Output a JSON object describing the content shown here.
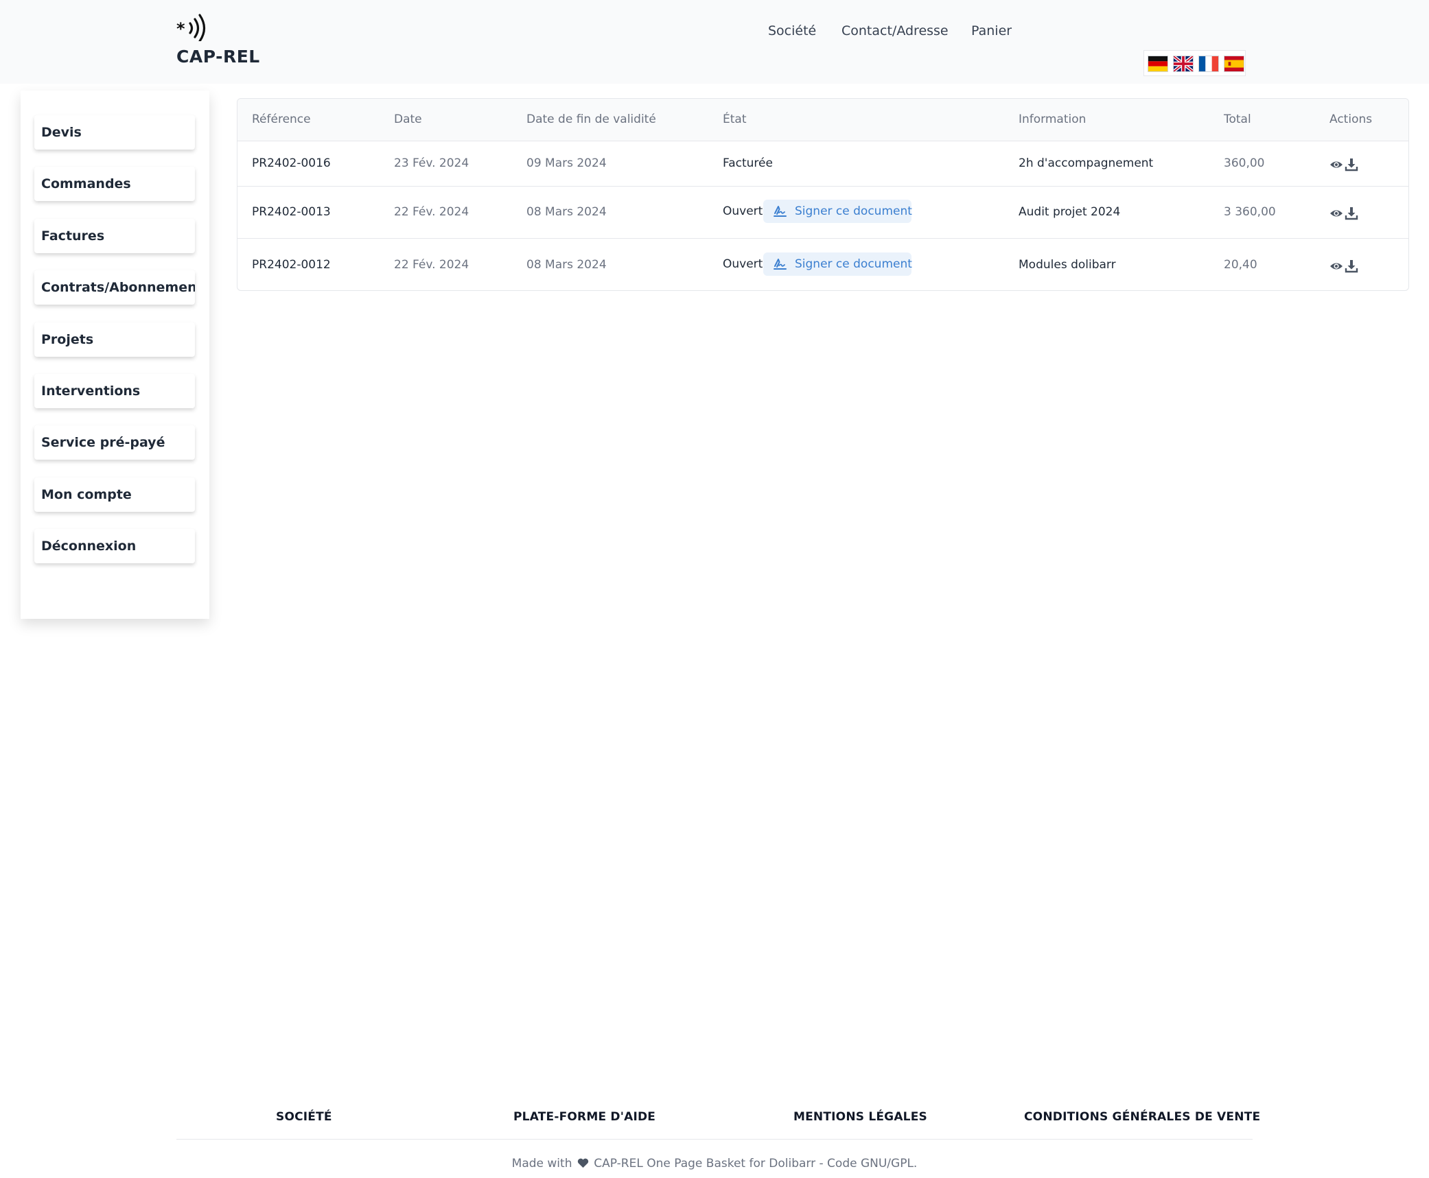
{
  "brand": {
    "name": "CAP-REL",
    "logo_icon": "nfc-waves-icon"
  },
  "nav": [
    {
      "label": "Société"
    },
    {
      "label": "Contact/Adresse"
    },
    {
      "label": "Panier"
    }
  ],
  "languages": [
    {
      "code": "de",
      "icon": "flag-germany-icon"
    },
    {
      "code": "en",
      "icon": "flag-uk-icon"
    },
    {
      "code": "fr",
      "icon": "flag-france-icon"
    },
    {
      "code": "es",
      "icon": "flag-spain-icon"
    }
  ],
  "sidebar": {
    "items": [
      {
        "label": "Devis"
      },
      {
        "label": "Commandes"
      },
      {
        "label": "Factures"
      },
      {
        "label": "Contrats/Abonnements"
      },
      {
        "label": "Projets"
      },
      {
        "label": "Interventions"
      },
      {
        "label": "Service pré-payé"
      },
      {
        "label": "Mon compte"
      },
      {
        "label": "Déconnexion"
      }
    ]
  },
  "table": {
    "columns": [
      "Référence",
      "Date",
      "Date de fin de validité",
      "État",
      "Information",
      "Total",
      "Actions"
    ],
    "rows": [
      {
        "reference": "PR2402-0016",
        "date": "23 Fév. 2024",
        "end_date": "09 Mars 2024",
        "state": "Facturée",
        "sign_label": "",
        "information": "2h d'accompagnement",
        "total": "360,00"
      },
      {
        "reference": "PR2402-0013",
        "date": "22 Fév. 2024",
        "end_date": "08 Mars 2024",
        "state": "Ouvert",
        "sign_label": "Signer ce document",
        "information": "Audit projet 2024",
        "total": "3 360,00"
      },
      {
        "reference": "PR2402-0012",
        "date": "22 Fév. 2024",
        "end_date": "08 Mars 2024",
        "state": "Ouvert",
        "sign_label": "Signer ce document",
        "information": "Modules dolibarr",
        "total": "20,40"
      }
    ],
    "action_icons": [
      "eye-icon",
      "download-icon"
    ],
    "sign_icon": "signature-icon"
  },
  "footer": {
    "links": [
      {
        "label": "SOCIÉTÉ"
      },
      {
        "label": "PLATE-FORME D'AIDE"
      },
      {
        "label": "MENTIONS LÉGALES"
      },
      {
        "label": "CONDITIONS GÉNÉRALES DE VENTE"
      }
    ],
    "credit_prefix": "Made with",
    "credit_suffix": "CAP-REL One Page Basket for Dolibarr - Code GNU/GPL."
  },
  "colors": {
    "accent": "#3b7fd0",
    "sign_button_bg": "#eaf2fb",
    "header_bg": "#f9fafb"
  }
}
